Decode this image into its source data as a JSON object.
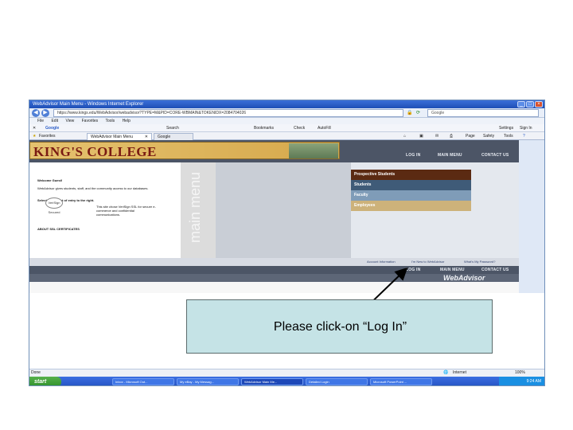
{
  "window": {
    "title": "WebAdvisor Main Menu - Windows Internet Explorer",
    "controls": [
      "_",
      "□",
      "×"
    ]
  },
  "address_bar": {
    "url": "https://www.kings.edu/WebAdvisor/webadvisor?TYPE=M&PID=CORE-WBMAIN&TOKENIDX=2084704026",
    "search_placeholder": "Google"
  },
  "menu": [
    "File",
    "Edit",
    "View",
    "Favorites",
    "Tools",
    "Help"
  ],
  "toolbar": {
    "google": "Google",
    "search": "Search",
    "bookmarks": "Bookmarks",
    "check": "Check",
    "autofill": "AutoFill",
    "settings": "Settings",
    "signin": "Sign In"
  },
  "tabs": {
    "favorites": "Favorites",
    "tab1": "WebAdvisor Main Menu",
    "tab2": "Google",
    "page_menu": "Page",
    "safety_menu": "Safety",
    "tools_menu": "Tools"
  },
  "site": {
    "logo": "KING'S COLLEGE",
    "nav": [
      "LOG IN",
      "MAIN MENU",
      "CONTACT US"
    ],
    "welcome": "Welcome Guest!",
    "intro": "WebAdvisor gives students, staff, and the community access to our databases.",
    "select": "Select your point of entry to the right.",
    "verisign_badge": "VeriSign Secured",
    "verisign_text": "This site chose VeriSign SSL for secure e-commerce and confidential communications.",
    "about_ssl": "ABOUT SSL CERTIFICATES",
    "side_label": "main menu",
    "menu_items": [
      {
        "label": "Prospective Students",
        "color": "#5b2a12"
      },
      {
        "label": "Students",
        "color": "#3f5b78"
      },
      {
        "label": "Faculty",
        "color": "#7f9cb8"
      },
      {
        "label": "Employees",
        "color": "#cdb27a"
      }
    ],
    "footer_links": [
      "Account Information",
      "I'm New to WebAdvisor",
      "What's My Password?"
    ],
    "footer_nav": [
      "LOG IN",
      "MAIN MENU",
      "CONTACT US"
    ],
    "brand": "WebAdvisor"
  },
  "status": {
    "left": "Done",
    "zone": "Internet",
    "zoom": "100%"
  },
  "taskbar": {
    "start": "start",
    "items": [
      "Inbox - Microsoft Out...",
      "My eBay - My Messag...",
      "WebAdvisor Main Me...",
      "Detailed Login",
      "Microsoft PowerPoint ..."
    ],
    "clock": "9:24 AM"
  },
  "callout": {
    "text": "Please click-on “Log In”"
  }
}
